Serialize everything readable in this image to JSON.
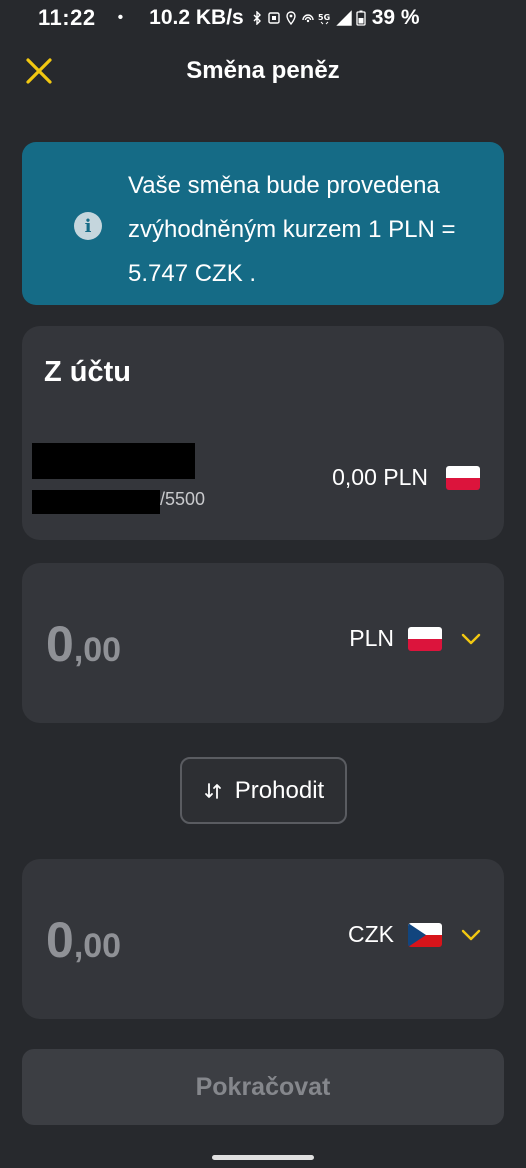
{
  "status_bar": {
    "time": "11:22",
    "dot": "•",
    "speed": "10.2 KB/s",
    "battery": "39 %",
    "icons": [
      "bluetooth-icon",
      "nfc-icon",
      "location-icon",
      "hotspot-icon",
      "5g-icon",
      "signal-icon",
      "battery-icon"
    ]
  },
  "header": {
    "title": "Směna peněz",
    "close_icon": "close-icon"
  },
  "info_banner": {
    "text": "Vaše směna bude provedena zvýhodněným kurzem 1 PLN = 5.747 CZK .",
    "icon": "info-icon"
  },
  "from_account": {
    "title": "Z účtu",
    "account_suffix": "/5500",
    "balance": "0,00 PLN",
    "flag": "poland-flag-icon"
  },
  "source_amount": {
    "integer": "0",
    "decimal": ",00",
    "currency": "PLN",
    "flag": "poland-flag-icon"
  },
  "swap_button": {
    "label": "Prohodit",
    "icon": "swap-arrows-icon"
  },
  "target_amount": {
    "integer": "0",
    "decimal": ",00",
    "currency": "CZK",
    "flag": "czech-flag-icon"
  },
  "continue_button": {
    "label": "Pokračovat"
  },
  "colors": {
    "background": "#27292d",
    "card": "#34363b",
    "banner": "#156b86",
    "accent": "#f2c811",
    "muted_text": "#8f9196"
  }
}
